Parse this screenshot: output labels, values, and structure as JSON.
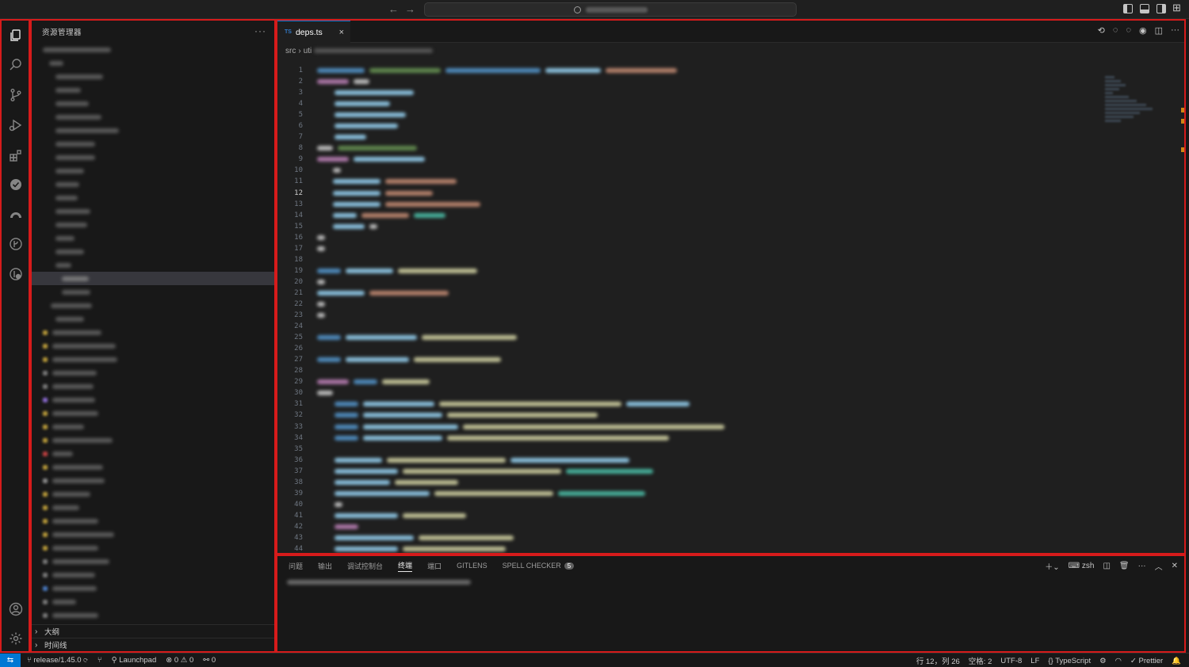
{
  "explorer": {
    "title": "资源管理器",
    "more": "···",
    "sections": [
      {
        "label": "大纲"
      },
      {
        "label": "时间线"
      }
    ]
  },
  "editor": {
    "tab": {
      "lang_badge": "TS",
      "filename": "deps.ts",
      "close": "×"
    },
    "breadcrumb": {
      "root": "src",
      "sep": "›",
      "next": "uti"
    },
    "line_numbers": [
      "1",
      "2",
      "3",
      "4",
      "5",
      "6",
      "7",
      "8",
      "9",
      "10",
      "11",
      "12",
      "13",
      "14",
      "15",
      "16",
      "17",
      "18",
      "19",
      "20",
      "21",
      "22",
      "23",
      "24",
      "25",
      "26",
      "27",
      "28",
      "29",
      "30",
      "31",
      "32",
      "33",
      "34",
      "35",
      "36",
      "37",
      "38",
      "39",
      "40",
      "41",
      "42",
      "43",
      "44"
    ],
    "current_line": "12"
  },
  "panel": {
    "tabs": [
      {
        "label": "问题"
      },
      {
        "label": "输出"
      },
      {
        "label": "调试控制台"
      },
      {
        "label": "终端",
        "active": true
      },
      {
        "label": "端口"
      },
      {
        "label": "GITLENS"
      },
      {
        "label": "SPELL CHECKER",
        "badge": "5"
      }
    ],
    "shell": "zsh"
  },
  "statusbar": {
    "branch": "release/1.45.0",
    "launchpad": "Launchpad",
    "errors": "0",
    "warnings": "0",
    "ports": "0",
    "cursor": "行 12，列 26",
    "spaces": "空格: 2",
    "encoding": "UTF-8",
    "eol": "LF",
    "language": "TypeScript",
    "prettier": "Prettier"
  },
  "colors": {
    "accent": "#0078d4",
    "highlight_border": "#d61b1b",
    "background": "#1f1f1f"
  }
}
